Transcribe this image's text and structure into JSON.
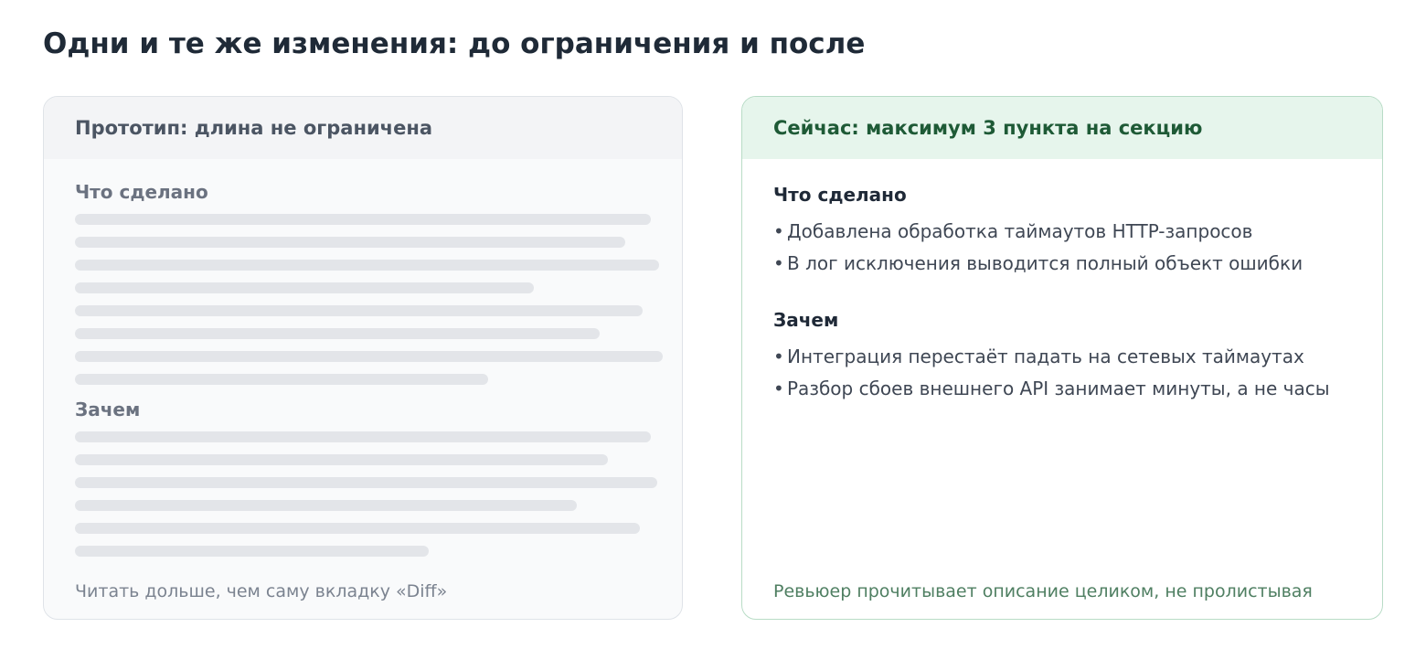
{
  "page": {
    "title": "Одни и те же изменения: до ограничения и после"
  },
  "before": {
    "header": "Прототип: длина не ограничена",
    "sections": [
      {
        "label": "Что сделано",
        "line_count": 8
      },
      {
        "label": "Зачем",
        "line_count": 6
      }
    ],
    "footer": "Читать дольше, чем саму вкладку «Diff»"
  },
  "after": {
    "header": "Сейчас: максимум 3 пункта на секцию",
    "sections": [
      {
        "label": "Что сделано",
        "items": [
          "Добавлена обработка таймаутов HTTP-запросов",
          "В лог исключения выводится полный объект ошибки"
        ]
      },
      {
        "label": "Зачем",
        "items": [
          "Интеграция перестаёт падать на сетевых таймаутах",
          "Разбор сбоев внешнего API занимает минуты, а не часы"
        ]
      }
    ],
    "footer": "Ревьюер прочитывает описание целиком, не пролистывая"
  },
  "bullet": "•",
  "colors": {
    "before_border": "#dfe3e8",
    "before_header_bg": "#f3f4f6",
    "after_border": "#b8dcc6",
    "after_header_bg": "#e6f5ec",
    "after_header_text": "#1e5a36",
    "after_footer_text": "#4f7f62",
    "placeholder": "#e3e5e9"
  }
}
